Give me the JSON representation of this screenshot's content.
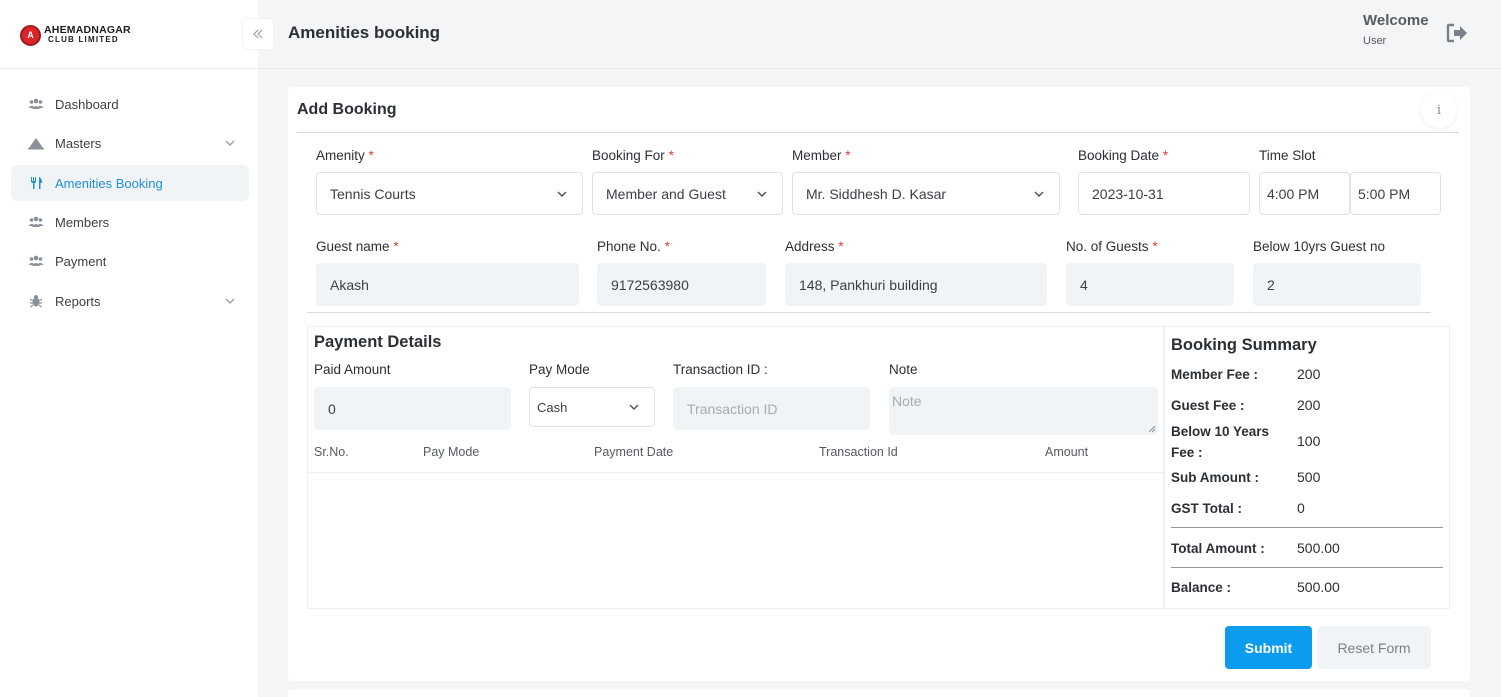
{
  "sidebar": {
    "logo_line1": "AHEMADNAGAR",
    "logo_line2": "CLUB LIMITED",
    "items": [
      {
        "label": "Dashboard"
      },
      {
        "label": "Masters"
      },
      {
        "label": "Amenities Booking"
      },
      {
        "label": "Members"
      },
      {
        "label": "Payment"
      },
      {
        "label": "Reports"
      }
    ]
  },
  "header": {
    "title": "Amenities booking",
    "welcome": "Welcome",
    "user": "User"
  },
  "form": {
    "card_title": "Add Booking",
    "info": "i",
    "amenity_label": "Amenity",
    "amenity_value": "Tennis Courts",
    "booking_for_label": "Booking For",
    "booking_for_value": "Member and Guest",
    "member_label": "Member",
    "member_value": "Mr. Siddhesh D. Kasar",
    "booking_date_label": "Booking Date",
    "booking_date_value": "2023-10-31",
    "time_slot_label": "Time Slot",
    "time_from": "4:00 PM",
    "time_to": "5:00 PM",
    "guest_name_label": "Guest name",
    "guest_name_value": "Akash",
    "phone_label": "Phone No.",
    "phone_value": "9172563980",
    "address_label": "Address",
    "address_value": "148, Pankhuri building",
    "guests_label": "No. of Guests",
    "guests_value": "4",
    "below10_label": "Below 10yrs Guest no",
    "below10_value": "2",
    "required_mark": "*"
  },
  "payment": {
    "title": "Payment Details",
    "paid_amount_label": "Paid Amount",
    "paid_amount_value": "0",
    "pay_mode_label": "Pay Mode",
    "pay_mode_value": "Cash",
    "transaction_label": "Transaction ID :",
    "transaction_placeholder": "Transaction ID",
    "note_label": "Note",
    "note_placeholder": "Note",
    "columns": [
      "Sr.No.",
      "Pay Mode",
      "Payment Date",
      "Transaction Id",
      "Amount"
    ]
  },
  "summary": {
    "title": "Booking Summary",
    "member_fee_label": "Member Fee :",
    "member_fee": "200",
    "guest_fee_label": "Guest Fee :",
    "guest_fee": "200",
    "below10_fee_label_1": "Below 10 Years",
    "below10_fee_label_2": "Fee :",
    "below10_fee": "100",
    "sub_amount_label": "Sub Amount :",
    "sub_amount": "500",
    "gst_label": "GST Total :",
    "gst": "0",
    "total_label": "Total Amount :",
    "total": "500.00",
    "balance_label": "Balance :",
    "balance": "500.00"
  },
  "actions": {
    "submit": "Submit",
    "reset": "Reset Form"
  },
  "colors": {
    "accent": "#0b9cf0",
    "active_nav": "#1f8fd6",
    "required": "#e03c3c"
  }
}
